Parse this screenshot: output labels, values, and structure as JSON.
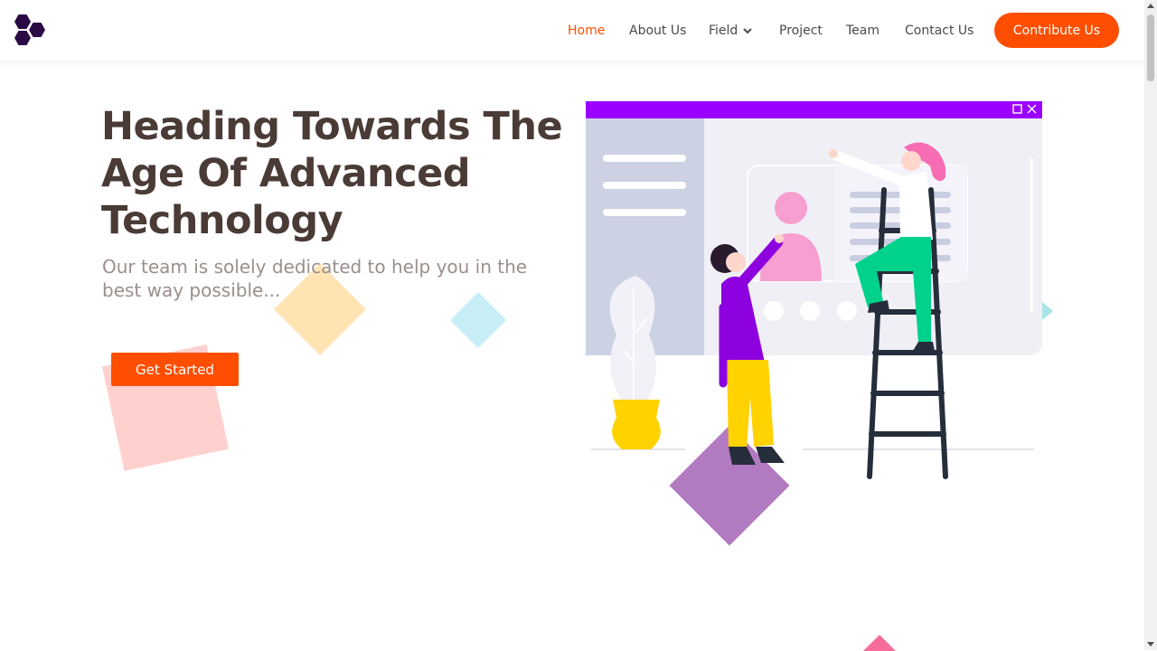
{
  "nav": {
    "items": [
      {
        "label": "Home",
        "active": true
      },
      {
        "label": "About Us"
      },
      {
        "label": "Field",
        "has_dropdown": true
      },
      {
        "label": "Project"
      },
      {
        "label": "Team"
      },
      {
        "label": "Contact Us"
      }
    ],
    "cta_label": "Contribute Us"
  },
  "hero": {
    "title_line1": "Heading Towards The",
    "title_line2": "Age Of Advanced",
    "title_line3": "Technology",
    "subtitle_line1": "Our team is solely dedicated to help you in the",
    "subtitle_line2": "best way possible...",
    "button_label": "Get Started"
  },
  "colors": {
    "accent": "#ff4e00",
    "heading": "#4a3b36",
    "subtext": "#9b8f8b",
    "logo": "#2a0a45",
    "window_bar": "#9b00ff"
  },
  "icons": {
    "logo": "hexagon-cluster-logo",
    "dropdown": "chevron-down-icon"
  }
}
